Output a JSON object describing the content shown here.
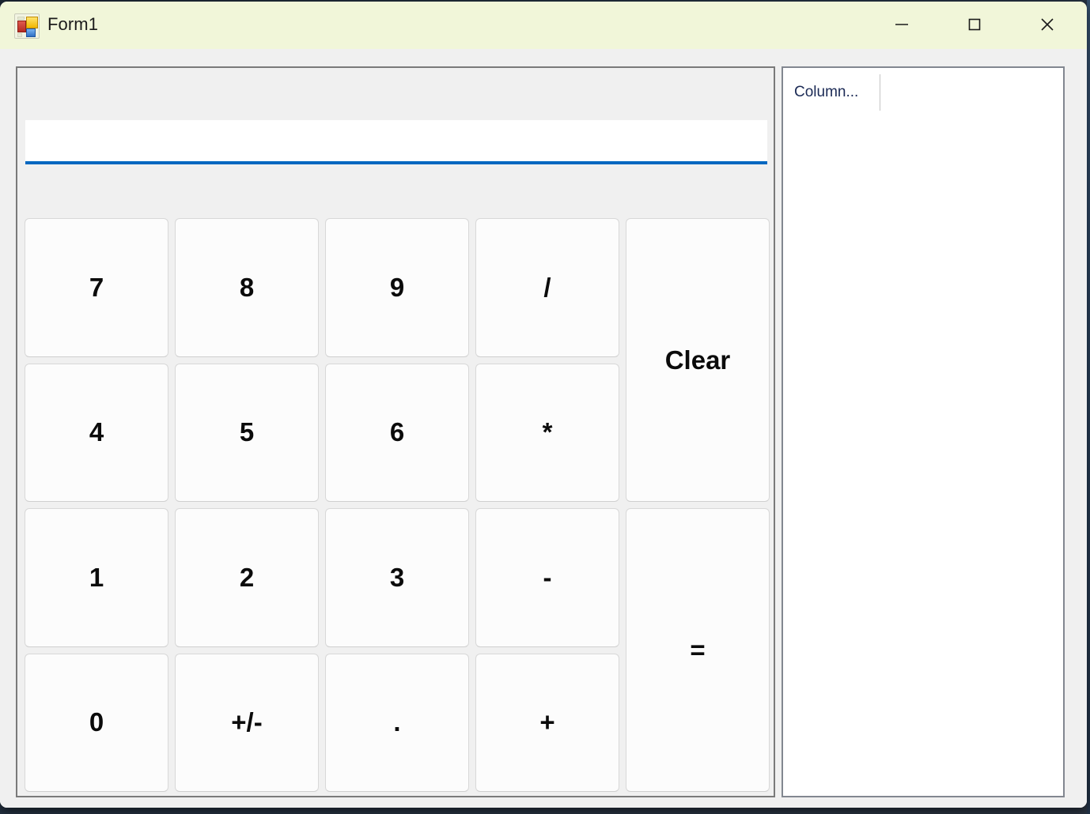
{
  "window": {
    "title": "Form1",
    "icon": "winforms-designer-icon",
    "titlebar_bg": "#f1f6d9",
    "client_bg": "#f0f0f0",
    "controls": [
      {
        "name": "minimize",
        "glyph": "—"
      },
      {
        "name": "maximize",
        "glyph": "□"
      },
      {
        "name": "close",
        "glyph": "✕"
      }
    ]
  },
  "calculator": {
    "display": {
      "value": "",
      "placeholder": "",
      "accent_color": "#0067c0"
    },
    "keys": [
      {
        "label": "7",
        "role": "digit",
        "span": 1
      },
      {
        "label": "8",
        "role": "digit",
        "span": 1
      },
      {
        "label": "9",
        "role": "digit",
        "span": 1
      },
      {
        "label": "/",
        "role": "operator",
        "span": 1
      },
      {
        "label": "Clear",
        "role": "clear",
        "span": 2
      },
      {
        "label": "4",
        "role": "digit",
        "span": 1
      },
      {
        "label": "5",
        "role": "digit",
        "span": 1
      },
      {
        "label": "6",
        "role": "digit",
        "span": 1
      },
      {
        "label": "*",
        "role": "operator",
        "span": 1
      },
      {
        "label": "1",
        "role": "digit",
        "span": 1
      },
      {
        "label": "2",
        "role": "digit",
        "span": 1
      },
      {
        "label": "3",
        "role": "digit",
        "span": 1
      },
      {
        "label": "-",
        "role": "operator",
        "span": 1
      },
      {
        "label": "=",
        "role": "equals",
        "span": 2
      },
      {
        "label": "0",
        "role": "digit",
        "span": 1
      },
      {
        "label": "+/-",
        "role": "sign",
        "span": 1
      },
      {
        "label": ".",
        "role": "decimal",
        "span": 1
      },
      {
        "label": "+",
        "role": "operator",
        "span": 1
      }
    ]
  },
  "grid": {
    "columns": [
      "Column..."
    ],
    "rows": []
  }
}
